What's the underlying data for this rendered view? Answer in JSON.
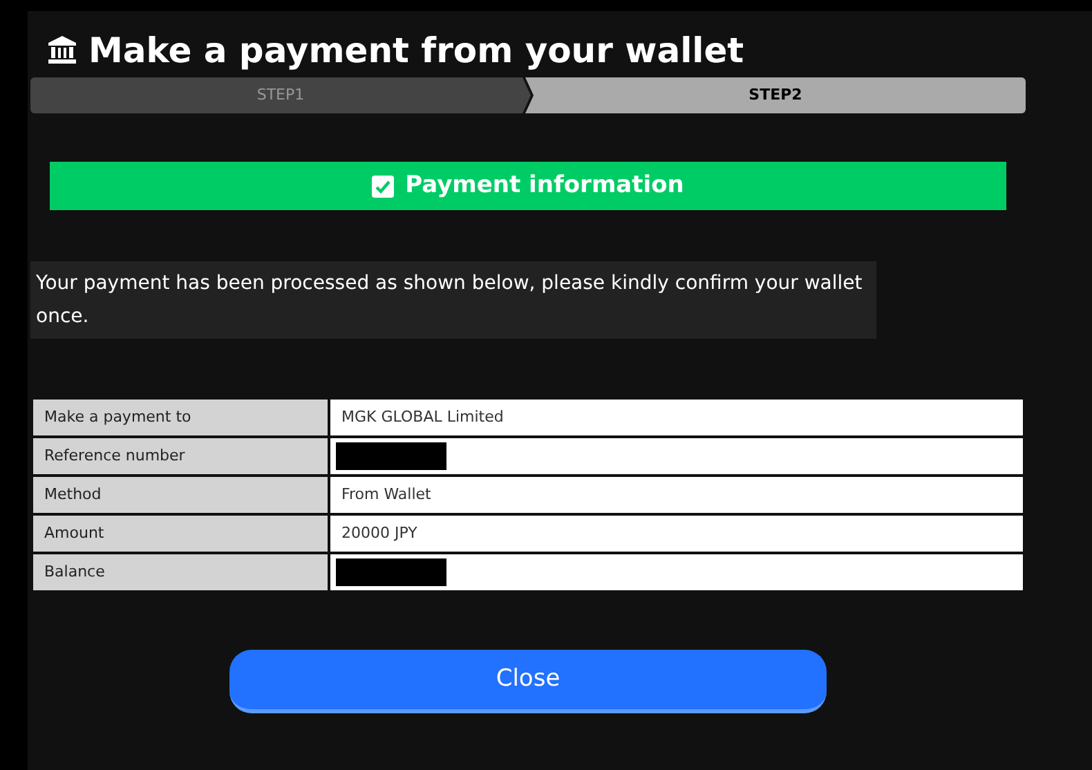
{
  "title": "Make a payment from your wallet",
  "steps": [
    {
      "label": "STEP1",
      "selected": false
    },
    {
      "label": "STEP2",
      "selected": true
    }
  ],
  "banner": {
    "label": "Payment information",
    "checked": true
  },
  "message": "Your payment has been processed as shown below, please kindly confirm your wallet once.",
  "details": [
    {
      "label": "Make a payment to",
      "kind": "text",
      "value": "MGK GLOBAL Limited"
    },
    {
      "label": "Reference number",
      "kind": "redacted"
    },
    {
      "label": "Method",
      "kind": "text",
      "value": "From Wallet"
    },
    {
      "label": "Amount",
      "kind": "text",
      "value": "20000 JPY"
    },
    {
      "label": "Balance",
      "kind": "redacted"
    }
  ],
  "button": "Close"
}
